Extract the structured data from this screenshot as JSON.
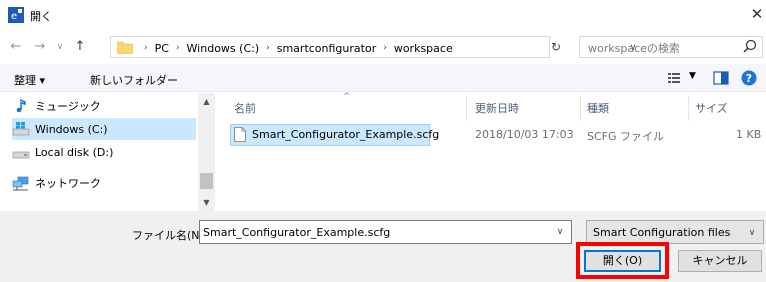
{
  "window": {
    "title": "開く",
    "close_glyph": "✕"
  },
  "address": {
    "breadcrumbs": [
      "PC",
      "Windows (C:)",
      "smartconfigurator",
      "workspace"
    ],
    "separator": "›",
    "search_placeholder": "workspaceの検索"
  },
  "toolbar": {
    "organize_label": "整理 ▾",
    "new_folder_label": "新しいフォルダー"
  },
  "nav_pane": {
    "items": [
      {
        "label": "ミュージック",
        "icon": "music-icon",
        "selected": false
      },
      {
        "label": "Windows (C:)",
        "icon": "windows-drive-icon",
        "selected": true
      },
      {
        "label": "Local disk (D:)",
        "icon": "drive-icon",
        "selected": false
      },
      {
        "label": "ネットワーク",
        "icon": "network-icon",
        "selected": false
      }
    ]
  },
  "file_list": {
    "columns": [
      "名前",
      "更新日時",
      "種類",
      "サイズ"
    ],
    "rows": [
      {
        "name": "Smart_Configurator_Example.scfg",
        "modified": "2018/10/03 17:03",
        "type": "SCFG ファイル",
        "size": "1 KB",
        "selected": true
      }
    ]
  },
  "bottom": {
    "filename_label": "ファイル名(N):",
    "filename_value": "Smart_Configurator_Example.scfg",
    "filetype_value": "Smart Configuration files",
    "open_button": "開く(O)",
    "cancel_button": "キャンセル"
  },
  "colors": {
    "highlight": "#ff0000",
    "selection": "#cce8ff",
    "accent": "#0078d7"
  }
}
